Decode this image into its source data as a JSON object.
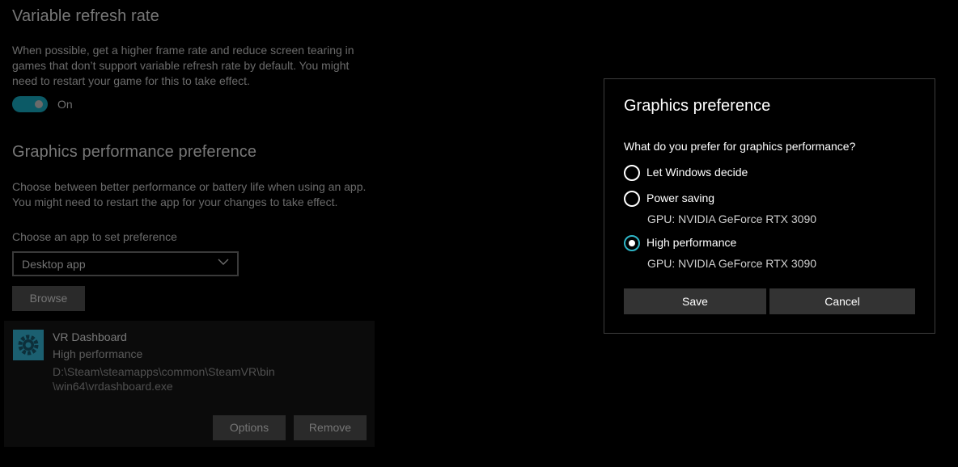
{
  "background": {
    "vrr": {
      "heading": "Variable refresh rate",
      "description_lines": [
        "When possible, get a higher frame rate and reduce screen tearing in",
        "games that don’t support variable refresh rate by default. You might",
        "need to restart your game for this to take effect."
      ],
      "toggle_label": "On",
      "toggle_state": "on"
    },
    "gpp": {
      "heading": "Graphics performance preference",
      "description_lines": [
        "Choose between better performance or battery life when using an app.",
        "You might need to restart the app for your changes to take effect."
      ],
      "choose_label": "Choose an app to set preference",
      "dropdown_value": "Desktop app",
      "browse_label": "Browse"
    },
    "app_card": {
      "name": "VR Dashboard",
      "preference": "High performance",
      "path_lines": [
        "D:\\Steam\\steamapps\\common\\SteamVR\\bin",
        "\\win64\\vrdashboard.exe"
      ],
      "options_label": "Options",
      "remove_label": "Remove",
      "icon": "gear-icon"
    }
  },
  "dialog": {
    "title": "Graphics preference",
    "question": "What do you prefer for graphics performance?",
    "options": [
      {
        "label": "Let Windows decide",
        "gpu": "",
        "selected": false
      },
      {
        "label": "Power saving",
        "gpu": "GPU: NVIDIA GeForce RTX 3090",
        "selected": false
      },
      {
        "label": "High performance",
        "gpu": "GPU: NVIDIA GeForce RTX 3090",
        "selected": true
      }
    ],
    "save_label": "Save",
    "cancel_label": "Cancel"
  },
  "colors": {
    "accent": "#2fb5c6",
    "toggle_track": "#0c5a66",
    "app_icon_bg": "#1b5f70"
  }
}
